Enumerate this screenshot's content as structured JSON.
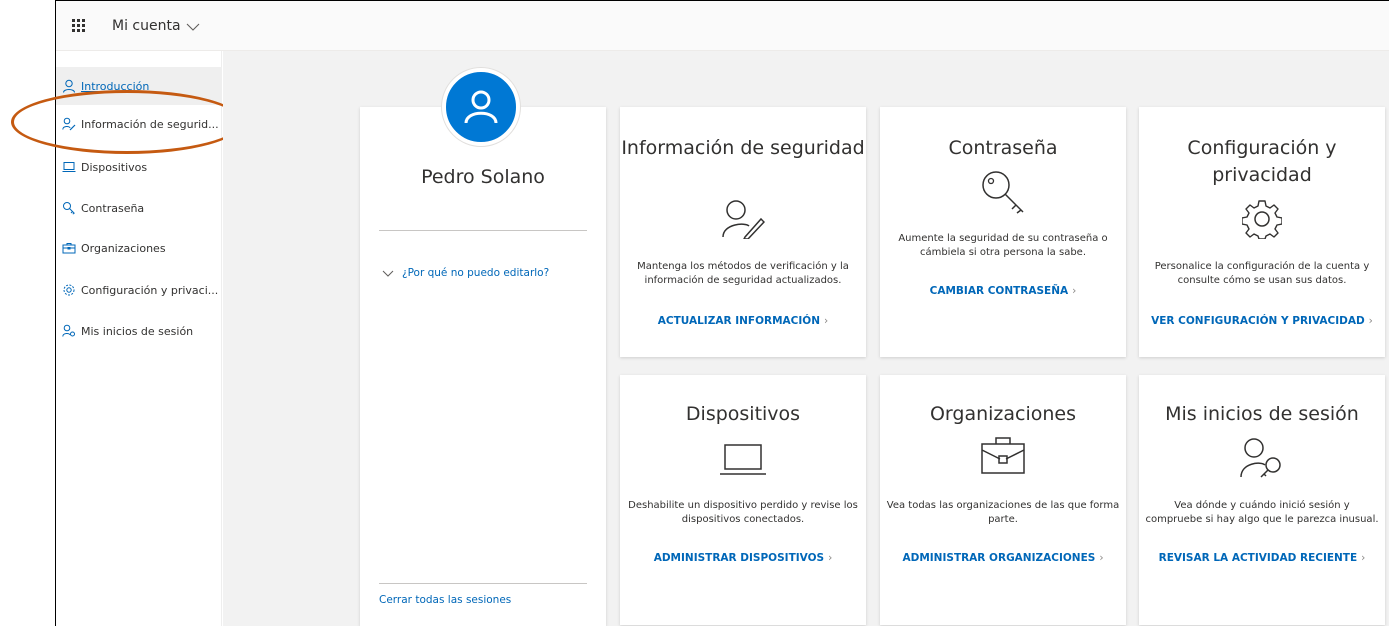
{
  "header": {
    "app_title": "Mi cuenta"
  },
  "sidebar": {
    "items": [
      {
        "label": "Introducción",
        "icon": "person-icon",
        "active": true
      },
      {
        "label": "Información de segurid...",
        "icon": "person-key-icon"
      },
      {
        "label": "Dispositivos",
        "icon": "laptop-icon"
      },
      {
        "label": "Contraseña",
        "icon": "key-icon"
      },
      {
        "label": "Organizaciones",
        "icon": "briefcase-icon"
      },
      {
        "label": "Configuración y privaci...",
        "icon": "gear-icon"
      },
      {
        "label": "Mis inicios de sesión",
        "icon": "person-key-icon"
      }
    ]
  },
  "profile": {
    "name": "Pedro Solano",
    "why_link": "¿Por qué no puedo editarlo?",
    "signout_link": "Cerrar todas las sesiones"
  },
  "tiles": [
    {
      "title": "Información de seguridad",
      "icon": "person-pen-icon",
      "description": "Mantenga los métodos de verificación y la información de seguridad actualizados.",
      "link": "ACTUALIZAR INFORMACIÓN"
    },
    {
      "title": "Contraseña",
      "icon": "key-icon",
      "description": "Aumente la seguridad de su contraseña o cámbiela si otra persona la sabe.",
      "link": "CAMBIAR CONTRASEÑA"
    },
    {
      "title": "Configuración y privacidad",
      "icon": "gear-icon",
      "description": "Personalice la configuración de la cuenta y consulte cómo se usan sus datos.",
      "link": "VER CONFIGURACIÓN Y PRIVACIDAD"
    },
    {
      "title": "Dispositivos",
      "icon": "laptop-icon",
      "description": "Deshabilite un dispositivo perdido y revise los dispositivos conectados.",
      "link": "ADMINISTRAR DISPOSITIVOS"
    },
    {
      "title": "Organizaciones",
      "icon": "briefcase-icon",
      "description": "Vea todas las organizaciones de las que forma parte.",
      "link": "ADMINISTRAR ORGANIZACIONES"
    },
    {
      "title": "Mis inicios de sesión",
      "icon": "person-key-icon",
      "description": "Vea dónde y cuándo inició sesión y compruebe si hay algo que le parezca inusual.",
      "link": "REVISAR LA ACTIVIDAD RECIENTE"
    }
  ],
  "colors": {
    "accent": "#0078d4",
    "link": "#0067b8",
    "annotation": "#c55a11"
  }
}
